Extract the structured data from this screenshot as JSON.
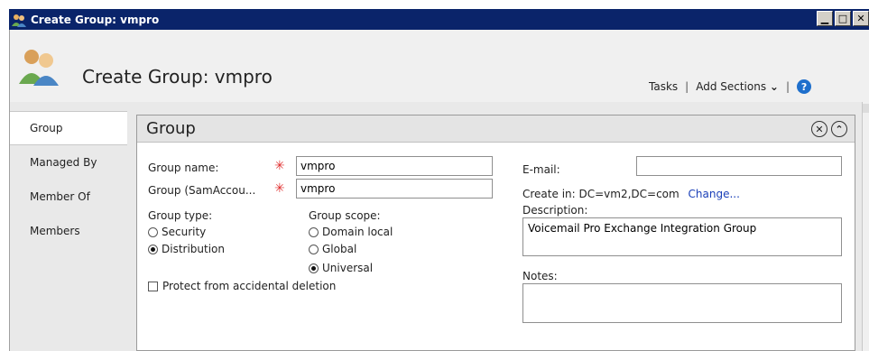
{
  "window": {
    "title": "Create Group: vmpro"
  },
  "header": {
    "title": "Create Group: vmpro",
    "tasks_label": "Tasks",
    "add_sections_label": "Add Sections",
    "separator": "|"
  },
  "nav": {
    "items": [
      {
        "label": "Group",
        "active": true
      },
      {
        "label": "Managed By",
        "active": false
      },
      {
        "label": "Member Of",
        "active": false
      },
      {
        "label": "Members",
        "active": false
      }
    ]
  },
  "panel": {
    "title": "Group",
    "group_name": {
      "label": "Group name:",
      "value": "vmpro"
    },
    "sam_account": {
      "label": "Group (SamAccou...",
      "value": "vmpro"
    },
    "email": {
      "label": "E-mail:",
      "value": ""
    },
    "create_in": {
      "label": "Create in:",
      "value": "DC=vm2,DC=com",
      "change_label": "Change..."
    },
    "group_type": {
      "label": "Group type:",
      "options": [
        {
          "label": "Security",
          "selected": false
        },
        {
          "label": "Distribution",
          "selected": true
        }
      ]
    },
    "group_scope": {
      "label": "Group scope:",
      "options": [
        {
          "label": "Domain local",
          "selected": false
        },
        {
          "label": "Global",
          "selected": false
        },
        {
          "label": "Universal",
          "selected": true
        }
      ]
    },
    "protect": {
      "label": "Protect from accidental deletion",
      "checked": false
    },
    "description": {
      "label": "Description:",
      "value": "Voicemail Pro Exchange Integration Group"
    },
    "notes": {
      "label": "Notes:",
      "value": ""
    }
  },
  "colors": {
    "titlebar": "#0a246a",
    "required": "#e03030",
    "link": "#1a3fb8"
  }
}
